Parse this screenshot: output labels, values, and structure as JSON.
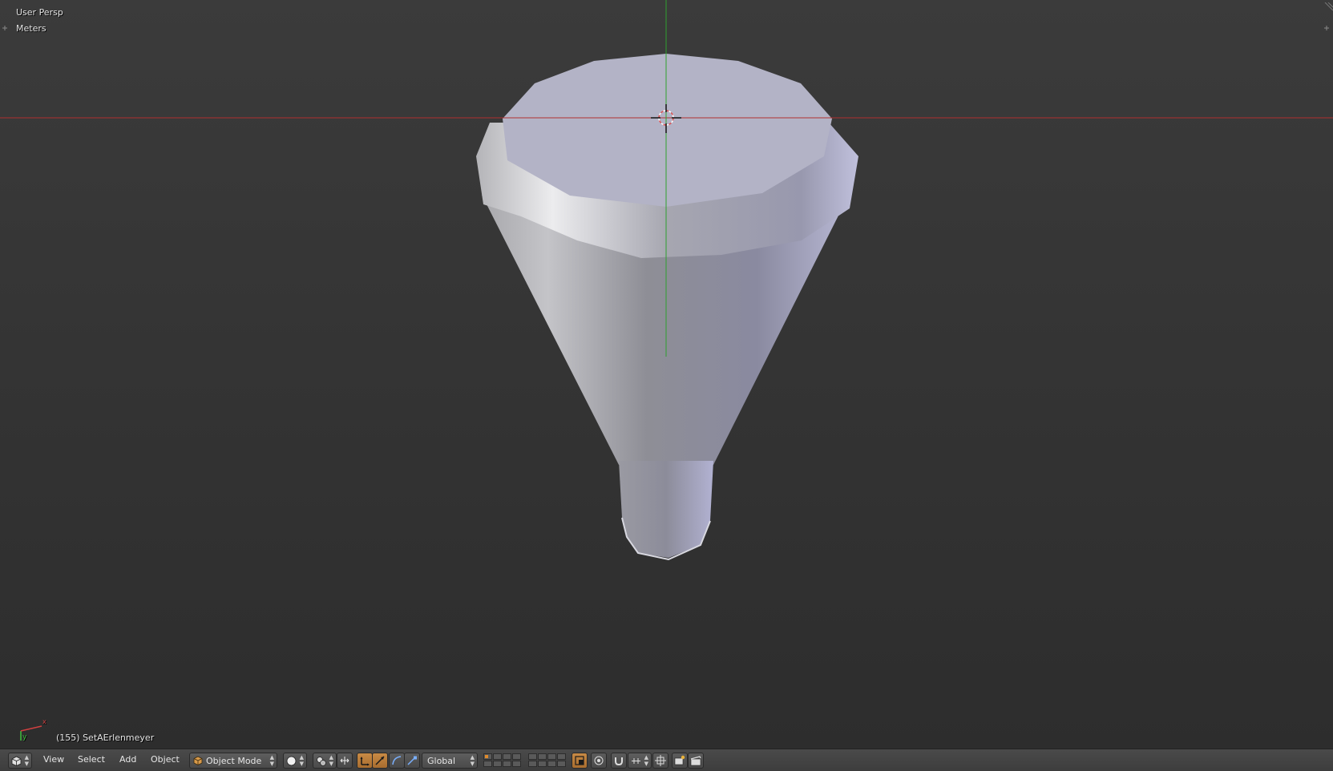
{
  "viewport": {
    "view_name": "User Persp",
    "units": "Meters",
    "object_info": "(155) SetAErlenmeyer",
    "axis_labels": {
      "x": "x",
      "y": "y"
    }
  },
  "header": {
    "editor_icon": "3d-view-icon",
    "menus": [
      "View",
      "Select",
      "Add",
      "Object"
    ],
    "mode_label": "Object Mode",
    "orientation_label": "Global",
    "colors": {
      "active_button": "#c88a45",
      "x_axis": "#c83232",
      "y_axis": "#32b432"
    }
  }
}
